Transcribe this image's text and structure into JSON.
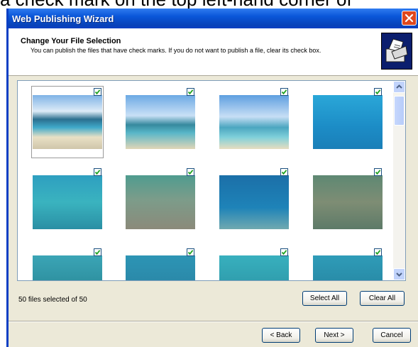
{
  "caption": "a check mark on the top left-hand corner of",
  "window": {
    "title": "Web Publishing Wizard"
  },
  "header": {
    "title": "Change Your File Selection",
    "subtitle": "You can publish the files that have check marks.  If you do not want to publish a file, clear its check box."
  },
  "thumbnails": [
    {
      "scene": "beach-with-boats",
      "checked": true,
      "selected": true
    },
    {
      "scene": "palm-tree-shore",
      "checked": true,
      "selected": false
    },
    {
      "scene": "palm-tree-lagoon",
      "checked": true,
      "selected": false
    },
    {
      "scene": "underwater-blue",
      "checked": true,
      "selected": false
    },
    {
      "scene": "reef-fish-school",
      "checked": true,
      "selected": false
    },
    {
      "scene": "coral-garden",
      "checked": true,
      "selected": false
    },
    {
      "scene": "single-fish",
      "checked": true,
      "selected": false
    },
    {
      "scene": "reef-parrotfish",
      "checked": true,
      "selected": false
    },
    {
      "scene": "reef-shallow",
      "checked": true,
      "selected": false
    },
    {
      "scene": "reef-yellow-fish",
      "checked": true,
      "selected": false
    },
    {
      "scene": "reef-turquoise",
      "checked": true,
      "selected": false
    },
    {
      "scene": "reef-striped-fish",
      "checked": true,
      "selected": false
    }
  ],
  "selection": {
    "status_text": "50 files selected of 50",
    "selected_count": 50,
    "total_count": 50
  },
  "buttons": {
    "select_all": "Select All",
    "clear_all": "Clear All",
    "back": "< Back",
    "next": "Next >",
    "cancel": "Cancel"
  },
  "colors": {
    "titlebar": "#0A56D8",
    "window_face": "#ECE9D8",
    "check_green": "#21A121"
  }
}
